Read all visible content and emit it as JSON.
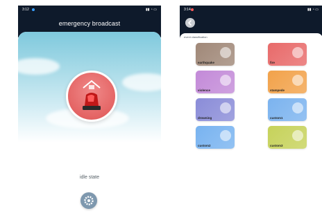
{
  "left": {
    "title": "emergency broadcast",
    "state_text": "idle state",
    "status_time": "3:12"
  },
  "right": {
    "section_label": "event classification",
    "status_time": "3:14",
    "tiles": [
      {
        "label": "earthquake",
        "color": "#a08878",
        "icon": "earthquake-house-icon"
      },
      {
        "label": "fire",
        "color": "#e86a6a",
        "icon": "fire-person-icon"
      },
      {
        "label": "violence",
        "color": "#c38ad8",
        "icon": "violence-icon"
      },
      {
        "label": "stampede",
        "color": "#f2a24a",
        "icon": "stampede-runner-icon"
      },
      {
        "label": "drowning",
        "color": "#8a8cd8",
        "icon": "drowning-swimmer-icon"
      },
      {
        "label": "custom1",
        "color": "#7bb3ef",
        "icon": "custom-person-icon"
      },
      {
        "label": "custom2",
        "color": "#78b3f0",
        "icon": "custom-megaphone-icon"
      },
      {
        "label": "custom3",
        "color": "#c6d25a",
        "icon": "custom-badge-icon"
      }
    ]
  },
  "colors": {
    "header": "#0e1a2b",
    "alarm": "#e46464",
    "settings": "#7e98ae"
  }
}
